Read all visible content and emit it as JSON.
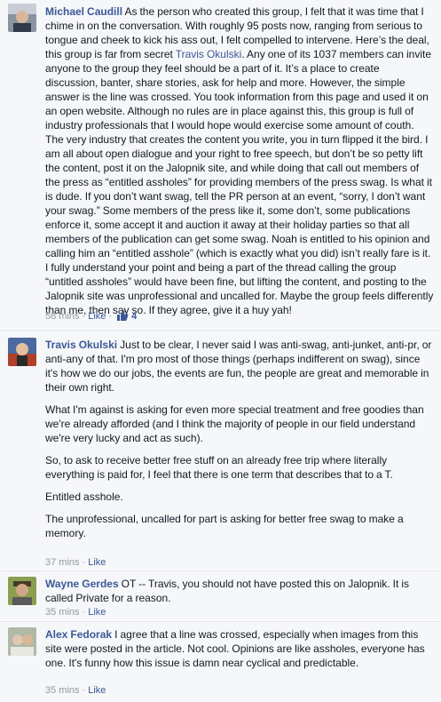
{
  "comments": [
    {
      "author": "Michael Caudill",
      "text_before_mention": "As the person who created this group, I felt that it was time that I chime in on the conversation. With roughly 95 posts now, ranging from serious to tongue and cheek to kick his ass out, I felt compelled to intervene. Here’s the deal, this group is far from secret ",
      "mention": "Travis Okulski",
      "text_after_mention": ". Any one of its 1037 members can invite anyone to the group they feel should be a part of it. It’s a place to create discussion, banter, share stories, ask for help and more. However, the simple answer is the line was crossed. You took information from this page and used it on an open website. Although no rules are in place against this, this group is full of industry professionals that I would hope would exercise some amount of couth. The very industry that creates the content you write, you in turn flipped it the bird. I am all about open dialogue and your right to free speech, but don’t be so petty lift the content, post it on the Jalopnik site, and while doing that call out members of the press as “entitled assholes” for providing members of the press swag. Is what it is dude. If you don’t want swag, tell the PR person at an event, “sorry, I don’t want your swag.” Some members of the press like it, some don’t, some publications enforce it, some accept it and auction it away at their holiday parties so that all members of the publication can get some swag. Noah is entitled to his opinion and calling him an “entitled asshole” (which is exactly what you did) isn’t really fare is it. I fully understand your point and being a part of the thread calling the group “untitled assholes” would have been fine, but lifting the content, and posting to the Jalopnik site was unprofessional and uncalled for. Maybe the group feels differently than me, then say so. If they agree, give it a huy yah!",
      "time": "58 mins",
      "like_label": "Like",
      "like_count": "4"
    },
    {
      "author": "Travis Okulski",
      "paragraphs": [
        "Just to be clear, I never said I was anti-swag, anti-junket, anti-pr, or anti-any of that. I'm pro most of those things (perhaps indifferent on swag), since it's how we do our jobs, the events are fun, the people are great and memorable in their own right.",
        "What I'm against is asking for even more special treatment and free goodies than we're already afforded (and I think the majority of people in our field understand we're very lucky and act as such).",
        "So, to ask to receive better free stuff on an already free trip where literally everything is paid for, I feel that there is one term that describes that to a T.",
        "Entitled asshole.",
        "The unprofessional, uncalled for part is asking for better free swag to make a memory."
      ],
      "time": "37 mins",
      "like_label": "Like"
    },
    {
      "author": "Wayne Gerdes",
      "text": "OT -- Travis, you should not have posted this on Jalopnik. It is called Private for a reason.",
      "time": "35 mins",
      "like_label": "Like"
    },
    {
      "author": "Alex Fedorak",
      "text": "I agree that a line was crossed, especially when images from this site were posted in the article. Not cool. Opinions are like assholes, everyone has one. It's funny how this issue is damn near cyclical and predictable.",
      "time": "35 mins",
      "like_label": "Like"
    }
  ],
  "colors": {
    "link": "#3b5998",
    "meta": "#9197a3",
    "text": "#141823",
    "background": "#f6f7f9"
  },
  "icons": [
    "thumbs-up-icon"
  ]
}
